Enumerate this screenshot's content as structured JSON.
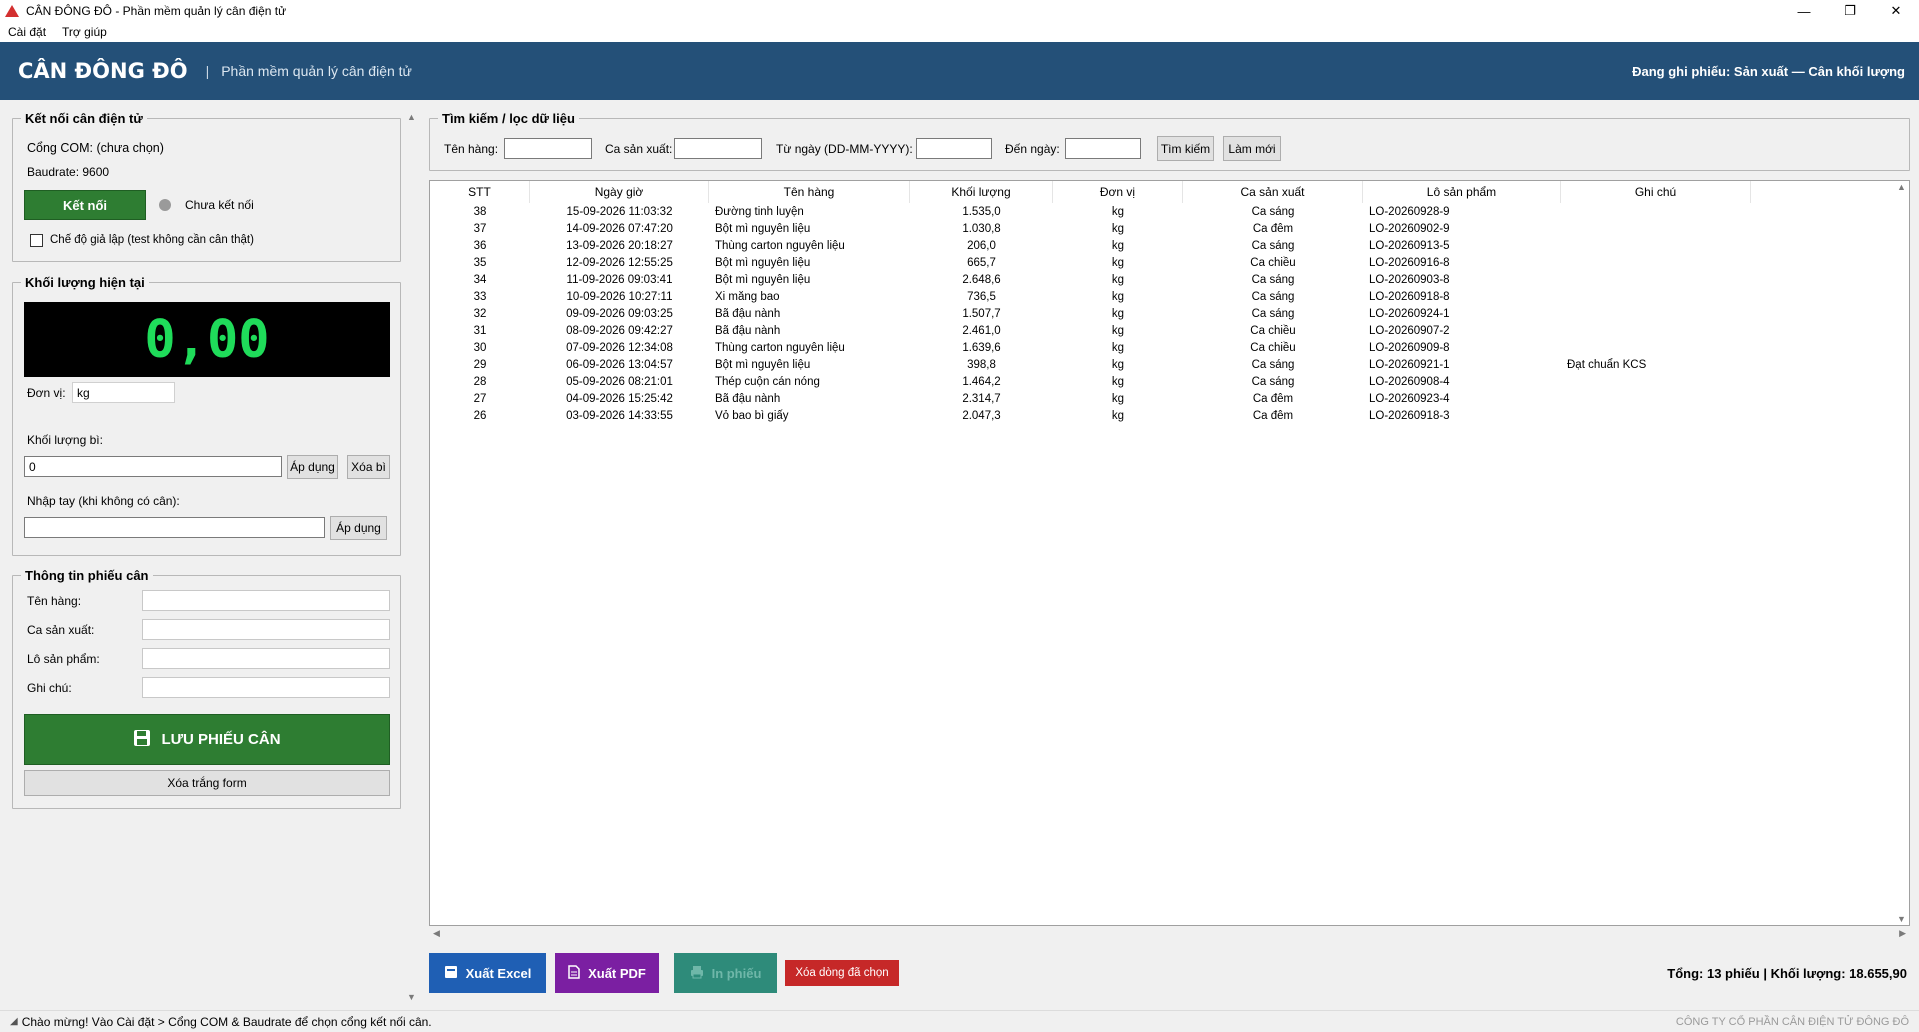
{
  "window": {
    "title": "CÂN ĐÔNG ĐÔ - Phần mềm quản lý cân điện tử",
    "minimize": "—",
    "maximize": "❐",
    "close": "✕"
  },
  "menu": [
    "Cài đặt",
    "Trợ giúp"
  ],
  "header": {
    "brand": "CÂN ĐÔNG ĐÔ",
    "separator": "|",
    "subtitle": "Phần mềm quản lý cân điện tử",
    "status": "Đang ghi phiếu: Sản xuất — Cân khối lượng"
  },
  "connection": {
    "legend": "Kết nối cân điện tử",
    "com_port": "Cổng COM: (chưa chọn)",
    "baudrate": "Baudrate: 9600",
    "connect_label": "Kết nối",
    "status_text": "Chưa kết nối",
    "simulate_label": "Chế độ giả lập (test không cần cân thật)"
  },
  "weight": {
    "legend": "Khối lượng hiện tại",
    "display": "0,00",
    "unit_label": "Đơn vị:",
    "unit_value": "kg",
    "tare_label": "Khối lượng bì:",
    "tare_value": "0",
    "apply_label": "Áp dụng",
    "clear_tare_label": "Xóa bì",
    "manual_label": "Nhập tay (khi không có cân):",
    "manual_value": "",
    "manual_apply_label": "Áp dụng"
  },
  "ticket": {
    "legend": "Thông tin phiếu cân",
    "product_label": "Tên hàng:",
    "shift_label": "Ca sản xuất:",
    "lot_label": "Lô sản phẩm:",
    "note_label": "Ghi chú:",
    "save_label": "LƯU PHIẾU CÂN",
    "clear_label": "Xóa trắng form"
  },
  "search": {
    "legend": "Tìm kiếm / lọc dữ liệu",
    "product_label": "Tên hàng:",
    "shift_label": "Ca sản xuất:",
    "from_label": "Từ ngày (DD-MM-YYYY):",
    "to_label": "Đến ngày:",
    "search_btn": "Tìm kiếm",
    "refresh_btn": "Làm mới"
  },
  "table": {
    "columns": [
      "STT",
      "Ngày giờ",
      "Tên hàng",
      "Khối lượng",
      "Đơn vị",
      "Ca sản xuất",
      "Lô sản phẩm",
      "Ghi chú"
    ],
    "rows": [
      [
        "38",
        "15-09-2026 11:03:32",
        "Đường tinh luyện",
        "1.535,0",
        "kg",
        "Ca sáng",
        "LO-20260928-9",
        ""
      ],
      [
        "37",
        "14-09-2026 07:47:20",
        "Bột mì nguyên liệu",
        "1.030,8",
        "kg",
        "Ca đêm",
        "LO-20260902-9",
        ""
      ],
      [
        "36",
        "13-09-2026 20:18:27",
        "Thùng carton nguyên liệu",
        "206,0",
        "kg",
        "Ca sáng",
        "LO-20260913-5",
        ""
      ],
      [
        "35",
        "12-09-2026 12:55:25",
        "Bột mì nguyên liệu",
        "665,7",
        "kg",
        "Ca chiều",
        "LO-20260916-8",
        ""
      ],
      [
        "34",
        "11-09-2026 09:03:41",
        "Bột mì nguyên liệu",
        "2.648,6",
        "kg",
        "Ca sáng",
        "LO-20260903-8",
        ""
      ],
      [
        "33",
        "10-09-2026 10:27:11",
        "Xi măng bao",
        "736,5",
        "kg",
        "Ca sáng",
        "LO-20260918-8",
        ""
      ],
      [
        "32",
        "09-09-2026 09:03:25",
        "Bã đậu nành",
        "1.507,7",
        "kg",
        "Ca sáng",
        "LO-20260924-1",
        ""
      ],
      [
        "31",
        "08-09-2026 09:42:27",
        "Bã đậu nành",
        "2.461,0",
        "kg",
        "Ca chiều",
        "LO-20260907-2",
        ""
      ],
      [
        "30",
        "07-09-2026 12:34:08",
        "Thùng carton nguyên liệu",
        "1.639,6",
        "kg",
        "Ca chiều",
        "LO-20260909-8",
        ""
      ],
      [
        "29",
        "06-09-2026 13:04:57",
        "Bột mì nguyên liệu",
        "398,8",
        "kg",
        "Ca sáng",
        "LO-20260921-1",
        "Đạt chuẩn KCS"
      ],
      [
        "28",
        "05-09-2026 08:21:01",
        "Thép cuộn cán nóng",
        "1.464,2",
        "kg",
        "Ca sáng",
        "LO-20260908-4",
        ""
      ],
      [
        "27",
        "04-09-2026 15:25:42",
        "Bã đậu nành",
        "2.314,7",
        "kg",
        "Ca đêm",
        "LO-20260923-4",
        ""
      ],
      [
        "26",
        "03-09-2026 14:33:55",
        "Vỏ bao bì giấy",
        "2.047,3",
        "kg",
        "Ca đêm",
        "LO-20260918-3",
        ""
      ]
    ]
  },
  "actions": {
    "excel": "Xuất Excel",
    "pdf": "Xuất PDF",
    "print": "In phiếu",
    "delete": "Xóa dòng đã chọn"
  },
  "summary": "Tổng: 13 phiếu | Khối lượng: 18.655,90",
  "statusbar": {
    "message": "Chào mừng! Vào Cài đặt > Cổng COM & Baudrate để chọn cổng kết nối cân.",
    "company": "CÔNG TY CỔ PHẦN CÂN ĐIỆN TỬ ĐÔNG ĐÔ"
  },
  "colors": {
    "header": "#245078",
    "green": "#2e7d32",
    "excel": "#1f5fb4",
    "pdf": "#7b1fa2",
    "print": "#2e8b7a",
    "delete": "#c62828"
  }
}
